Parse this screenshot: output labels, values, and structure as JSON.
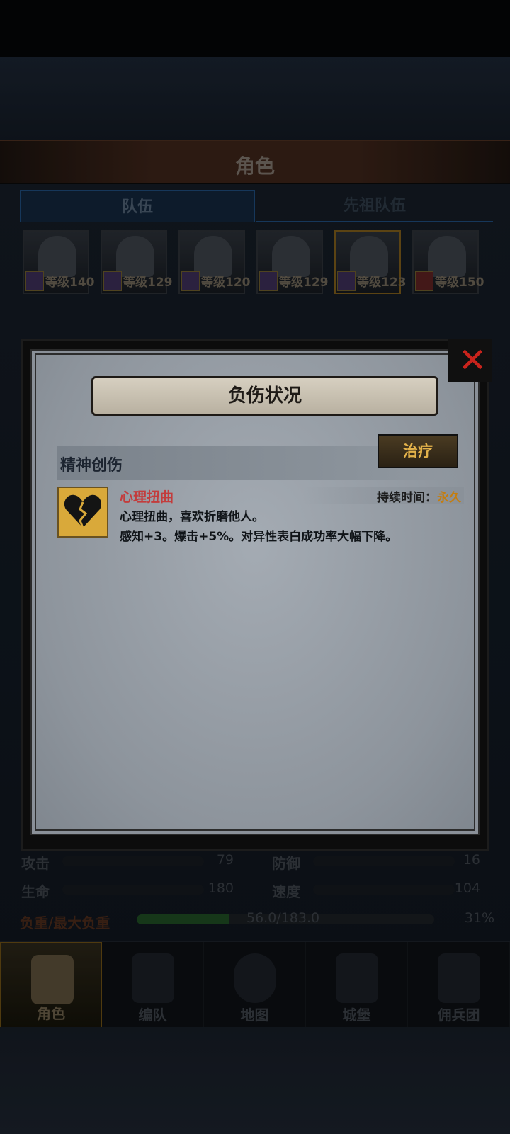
{
  "screen": {
    "title": "角色",
    "tabs": [
      {
        "label": "队伍",
        "active": true
      },
      {
        "label": "先祖队伍",
        "active": false
      }
    ],
    "heroes": [
      {
        "level": "等级140",
        "badge": "weapon-icon"
      },
      {
        "level": "等级129",
        "badge": "weapon-icon"
      },
      {
        "level": "等级120",
        "badge": "weapon-icon"
      },
      {
        "level": "等级129",
        "badge": "weapon-icon"
      },
      {
        "level": "等级123",
        "badge": "weapon-icon",
        "selected": true
      },
      {
        "level": "等级150",
        "badge": "beast-icon"
      }
    ],
    "stats": {
      "attack_label": "攻击",
      "attack_value": "79",
      "defense_label": "防御",
      "defense_value": "16",
      "hp_label": "生命",
      "hp_value": "180",
      "speed_label": "速度",
      "speed_value": "104",
      "weight_label": "负重/最大负重",
      "weight_value": "56.0/183.0",
      "weight_percent": "31%",
      "weight_fraction": 0.31
    },
    "nav": [
      {
        "label": "角色",
        "active": true,
        "icon": "knight-icon"
      },
      {
        "label": "编队",
        "icon": "helmet-icon"
      },
      {
        "label": "地图",
        "icon": "compass-icon"
      },
      {
        "label": "城堡",
        "icon": "castle-icon"
      },
      {
        "label": "佣兵团",
        "icon": "banner-icon"
      }
    ]
  },
  "modal": {
    "title": "负伤状况",
    "section_title": "精神创伤",
    "heal_label": "治疗",
    "close_icon": "close-icon",
    "injury": {
      "icon": "broken-heart-icon",
      "name": "心理扭曲",
      "duration_label": "持续时间：",
      "duration_value": "永久",
      "description": "心理扭曲，喜欢折磨他人。",
      "effects": "感知+3。爆击+5%。对异性表白成功率大幅下降。"
    }
  },
  "colors": {
    "accent_gold": "#e2b14a",
    "injury_red": "#c33c3c",
    "close_red": "#c8231c",
    "permanent_orange": "#c57d0d"
  }
}
